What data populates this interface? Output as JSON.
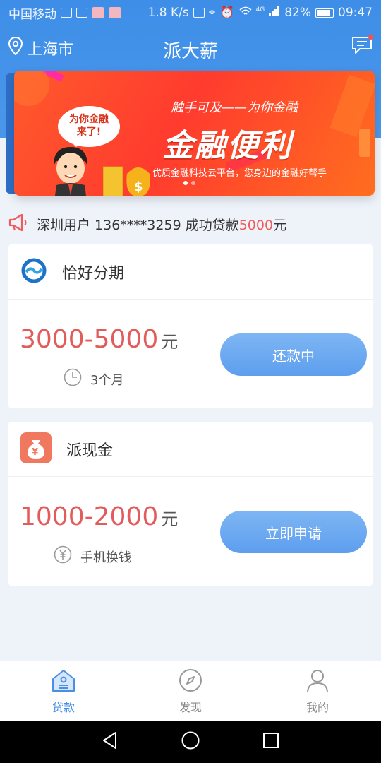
{
  "status_bar": {
    "carrier": "中国移动",
    "speed": "1.8 K/s",
    "network": "4G",
    "battery": "82%",
    "time": "09:47"
  },
  "header": {
    "city": "上海市",
    "title": "派大薪"
  },
  "banner": {
    "bubble_line1": "为你金融",
    "bubble_line2": "来了!",
    "subtitle": "触手可及——为你金融",
    "headline": "金融便利",
    "tagline": "优质金融科技云平台，您身边的金融好帮手"
  },
  "notice": {
    "prefix": "深圳用户 136****3259 成功贷款",
    "amount": "5000",
    "suffix": "元"
  },
  "products": [
    {
      "name": "恰好分期",
      "range": "3000-5000",
      "unit": "元",
      "meta": "3个月",
      "button": "还款中"
    },
    {
      "name": "派现金",
      "range": "1000-2000",
      "unit": "元",
      "meta": "手机换钱",
      "button": "立即申请"
    }
  ],
  "tabs": [
    {
      "label": "贷款",
      "icon": "home-icon"
    },
    {
      "label": "发现",
      "icon": "compass-icon"
    },
    {
      "label": "我的",
      "icon": "user-icon"
    }
  ],
  "colors": {
    "brand_blue": "#4a8fe4",
    "amount_red": "#e35c5c",
    "banner_red": "#ff3b2e"
  }
}
